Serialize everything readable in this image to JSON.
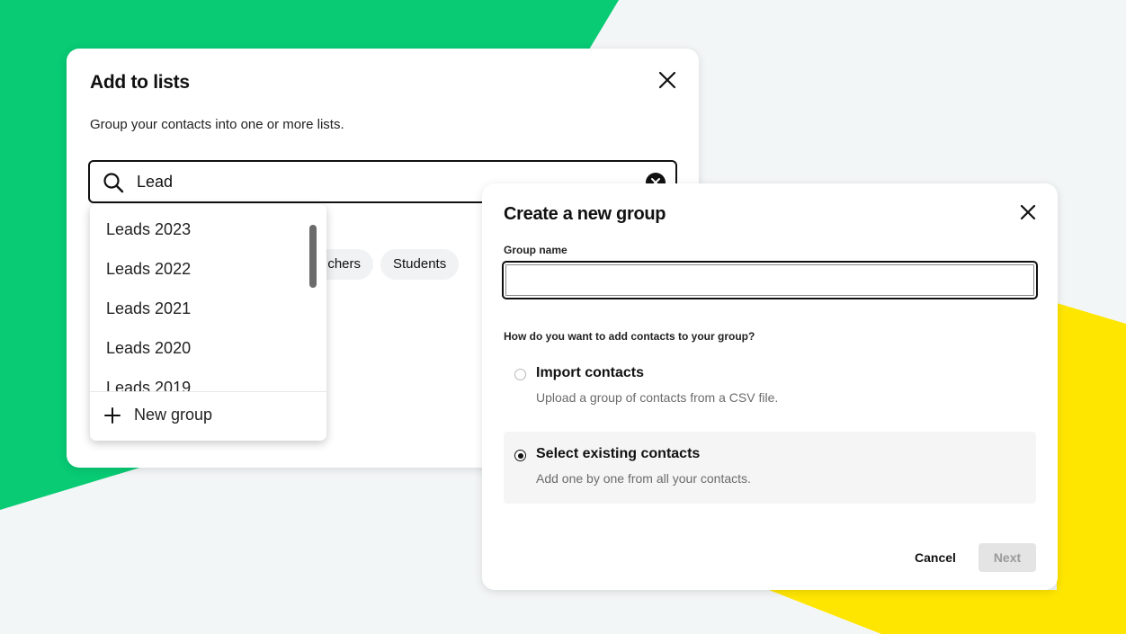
{
  "colors": {
    "brand_green": "#08cb74",
    "brand_yellow": "#ffe600",
    "background": "#f3f6f7"
  },
  "add_to_lists": {
    "title": "Add to lists",
    "subtitle": "Group your contacts into one or more lists.",
    "close_icon": "close-icon",
    "search": {
      "value": "Lead",
      "icon": "search-icon",
      "clear_icon": "clear-circle-icon"
    },
    "chips": [
      {
        "label": "chers"
      },
      {
        "label": "Students"
      }
    ],
    "dropdown": {
      "items": [
        {
          "label": "Leads 2023"
        },
        {
          "label": "Leads 2022"
        },
        {
          "label": "Leads 2021"
        },
        {
          "label": "Leads 2020"
        },
        {
          "label": "Leads 2019"
        }
      ],
      "new_group_label": "New group",
      "new_group_icon": "plus-icon"
    }
  },
  "create_group": {
    "title": "Create a new group",
    "close_icon": "close-icon",
    "group_name_label": "Group name",
    "group_name_value": "",
    "question": "How do you want to add contacts to your group?",
    "options": [
      {
        "title": "Import contacts",
        "description": "Upload a group of contacts from a CSV file.",
        "selected": false
      },
      {
        "title": "Select existing contacts",
        "description": "Add one by one from all your contacts.",
        "selected": true
      }
    ],
    "cancel_label": "Cancel",
    "next_label": "Next"
  }
}
